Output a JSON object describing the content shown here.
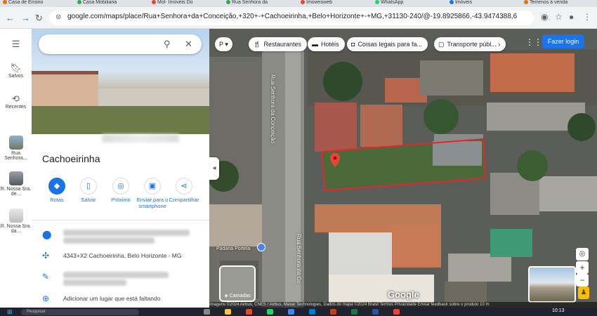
{
  "browser": {
    "tabs": [
      {
        "label": "Casa de Ensino",
        "color": "#e37400"
      },
      {
        "label": "Casa Mobiliaria",
        "color": "#34a853"
      },
      {
        "label": "Mol- Imoveis Do",
        "color": "#ea4335"
      },
      {
        "label": "Rua Senhora da",
        "color": "#34a853"
      },
      {
        "label": "Imoveisweb",
        "color": "#ea4335"
      },
      {
        "label": "WhatsApp",
        "color": "#25d366"
      },
      {
        "label": "Imóveis",
        "color": "#1a73e8"
      },
      {
        "label": "Terrenos à venda",
        "color": "#e37400"
      }
    ],
    "url": "google.com/maps/place/Rua+Senhora+da+Conceição,+320+-+Cachoeirinha,+Belo+Horizonte+-+MG,+31130-240/@-19.8925866,-43.9474388,69m/data=!3m1!1e3"
  },
  "rail": {
    "menu_icon": "hamburger-menu-icon",
    "saved_label": "Salvos",
    "recent_label": "Recentes",
    "recent_places": [
      {
        "label": "Rua Senhora..."
      },
      {
        "label": "R. Nossa Sra. de..."
      },
      {
        "label": "R. Nossa Sra. da..."
      }
    ]
  },
  "panel": {
    "search_value": "",
    "place_name": "Cachoeirinha",
    "actions": [
      {
        "label": "Rotas",
        "icon": "directions-icon"
      },
      {
        "label": "Salvar",
        "icon": "bookmark-icon"
      },
      {
        "label": "Próximo",
        "icon": "nearby-icon"
      },
      {
        "label": "Enviar para o smartphone",
        "icon": "send-to-phone-icon"
      },
      {
        "label": "Compartilhar",
        "icon": "share-icon"
      }
    ],
    "plus_code": "4343+X2 Cachoeirinha, Belo Horizonte - MG",
    "add_place": "Adicionar um lugar que está faltando"
  },
  "map": {
    "mode_chip": "P",
    "chips": [
      {
        "label": "Restaurantes",
        "icon": "restaurant-icon"
      },
      {
        "label": "Hotéis",
        "icon": "hotel-icon"
      },
      {
        "label": "Coisas legais para fa...",
        "icon": "camera-icon"
      },
      {
        "label": "Transporte públ...",
        "icon": "transit-icon"
      }
    ],
    "login_label": "Fazer login",
    "street_main": "Rua Senhora da Conceição",
    "street_lower": "Rua Senhora da Co",
    "poi_label": "Padaria Portela",
    "layers_label": "Camadas",
    "watermark": "Google",
    "attribution": "Imagens ©2024 Airbus, CNES / Airbus, Maxar Technologies, Dados do mapa ©2024   Brasil   Termos   Privacidade   Enviar feedback sobre o produto   10 m",
    "outline_color": "#e3262e"
  },
  "taskbar": {
    "search_placeholder": "Pesquisar",
    "time": "10:13"
  }
}
